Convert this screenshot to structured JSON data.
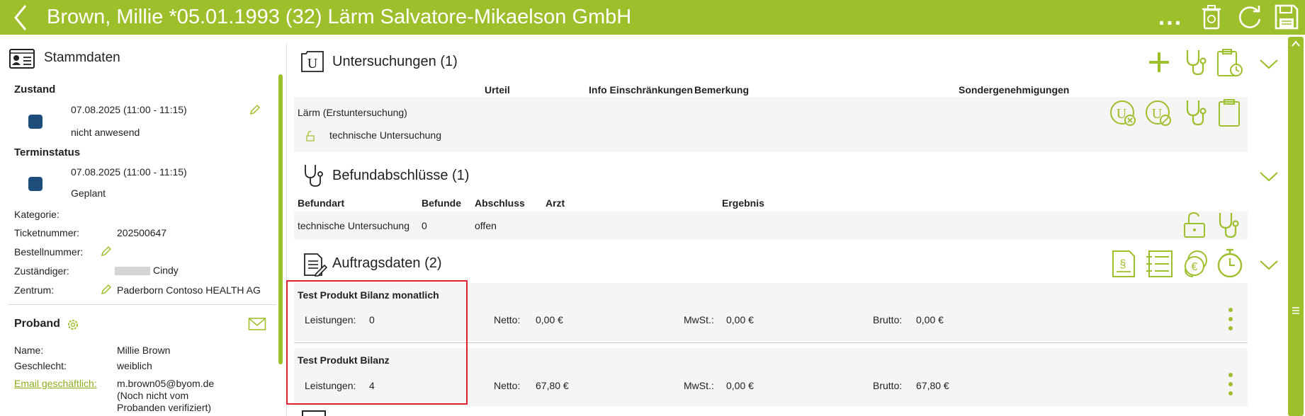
{
  "header": {
    "title": "Brown, Millie *05.01.1993 (32) Lärm Salvatore-Mikaelson GmbH",
    "more_label": "..."
  },
  "left": {
    "stammdaten_title": "Stammdaten",
    "zustand": {
      "label": "Zustand",
      "date": "07.08.2025 (11:00 - 11:15)",
      "status": "nicht anwesend"
    },
    "terminstatus": {
      "label": "Terminstatus",
      "date": "07.08.2025 (11:00 - 11:15)",
      "status": "Geplant"
    },
    "fields": {
      "kategorie_label": "Kategorie:",
      "ticket_label": "Ticketnummer:",
      "ticket_value": "202500647",
      "bestell_label": "Bestellnummer:",
      "zust_label": "Zuständiger:",
      "zust_value": "Cindy",
      "zentrum_label": "Zentrum:",
      "zentrum_value": "Paderborn Contoso HEALTH AG"
    },
    "proband": {
      "title": "Proband",
      "name_label": "Name:",
      "name_value": "Millie Brown",
      "geschlecht_label": "Geschlecht:",
      "geschlecht_value": "weiblich",
      "email_label": "Email geschäftlich:",
      "email_value": "m.brown05@byom.de",
      "email_note_1": "(Noch nicht vom",
      "email_note_2": "Probanden verifiziert)"
    }
  },
  "untersuchungen": {
    "title": "Untersuchungen (1)",
    "columns": [
      "Urteil",
      "Info Einschränkungen",
      "Bemerkung",
      "Sondergenehmigungen"
    ],
    "row_title": "Lärm (Erstuntersuchung)",
    "row_sub": "technische Untersuchung"
  },
  "befund": {
    "title": "Befundabschlüsse (1)",
    "columns": [
      "Befundart",
      "Befunde",
      "Abschluss",
      "Arzt",
      "Ergebnis"
    ],
    "row": [
      "technische Untersuchung",
      "0",
      "offen",
      "",
      ""
    ]
  },
  "auftrag": {
    "title": "Auftragsdaten (2)",
    "items": [
      {
        "name": "Test Produkt Bilanz monatlich",
        "leistungen_label": "Leistungen:",
        "leistungen": "0",
        "netto_label": "Netto:",
        "netto": "0,00 €",
        "mwst_label": "MwSt.:",
        "mwst": "0,00 €",
        "brutto_label": "Brutto:",
        "brutto": "0,00 €"
      },
      {
        "name": "Test Produkt Bilanz",
        "leistungen_label": "Leistungen:",
        "leistungen": "4",
        "netto_label": "Netto:",
        "netto": "67,80 €",
        "mwst_label": "MwSt.:",
        "mwst": "0,00 €",
        "brutto_label": "Brutto:",
        "brutto": "67,80 €"
      }
    ]
  },
  "colors": {
    "accent": "#9ebf2c",
    "status": "#1e4d7c",
    "highlight": "#d6232c"
  },
  "icons": [
    "back-arrow-icon",
    "more-icon",
    "recycle-bin-icon",
    "refresh-icon",
    "save-icon",
    "id-card-icon",
    "pencil-icon",
    "settings-icon",
    "mail-icon",
    "exam-u-icon",
    "plus-icon",
    "stethoscope-icon",
    "clipboard-clock-icon",
    "chevron-down-icon",
    "exam-cancel-icon",
    "exam-block-icon",
    "clipboard-icon",
    "unlock-icon",
    "document-icon",
    "paragraph-doc-icon",
    "list-icon",
    "coins-euro-icon",
    "stopwatch-icon",
    "kebab-icon"
  ]
}
